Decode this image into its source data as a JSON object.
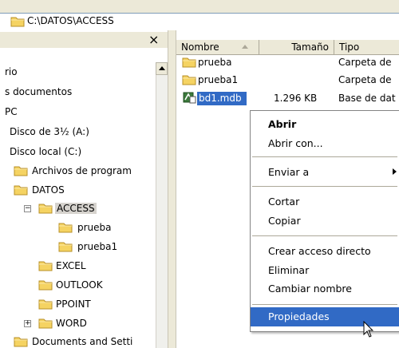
{
  "address": {
    "path": "C:\\DATOS\\ACCESS"
  },
  "tree": {
    "close_glyph": "×",
    "items": [
      {
        "label": "rio"
      },
      {
        "label": "s documentos"
      },
      {
        "label": "PC"
      },
      {
        "label": "Disco de 3½ (A:)"
      },
      {
        "label": "Disco local (C:)"
      },
      {
        "label": "Archivos de program"
      },
      {
        "label": "DATOS"
      },
      {
        "label": "ACCESS",
        "expander": "−"
      },
      {
        "label": "prueba"
      },
      {
        "label": "prueba1"
      },
      {
        "label": "EXCEL"
      },
      {
        "label": "OUTLOOK"
      },
      {
        "label": "PPOINT"
      },
      {
        "label": "WORD",
        "expander": "+"
      },
      {
        "label": "Documents and Setti"
      }
    ]
  },
  "list": {
    "columns": [
      {
        "label": "Nombre",
        "sort": "ascending"
      },
      {
        "label": "Tamaño"
      },
      {
        "label": "Tipo"
      }
    ],
    "rows": [
      {
        "name": "prueba",
        "size": "",
        "type": "Carpeta de"
      },
      {
        "name": "prueba1",
        "size": "",
        "type": "Carpeta de"
      },
      {
        "name": "bd1.mdb",
        "size": "1.296 KB",
        "type": "Base de dat"
      }
    ]
  },
  "context_menu": {
    "items": [
      {
        "label": "Abrir",
        "bold": true
      },
      {
        "label": "Abrir con..."
      },
      {
        "label": "Enviar a",
        "submenu": true
      },
      {
        "label": "Cortar"
      },
      {
        "label": "Copiar"
      },
      {
        "label": "Crear acceso directo"
      },
      {
        "label": "Eliminar"
      },
      {
        "label": "Cambiar nombre"
      },
      {
        "label": "Propiedades",
        "highlighted": true
      }
    ]
  },
  "colors": {
    "folder": "#f5d362",
    "selection": "#316ac5",
    "chrome": "#ece9d8"
  }
}
